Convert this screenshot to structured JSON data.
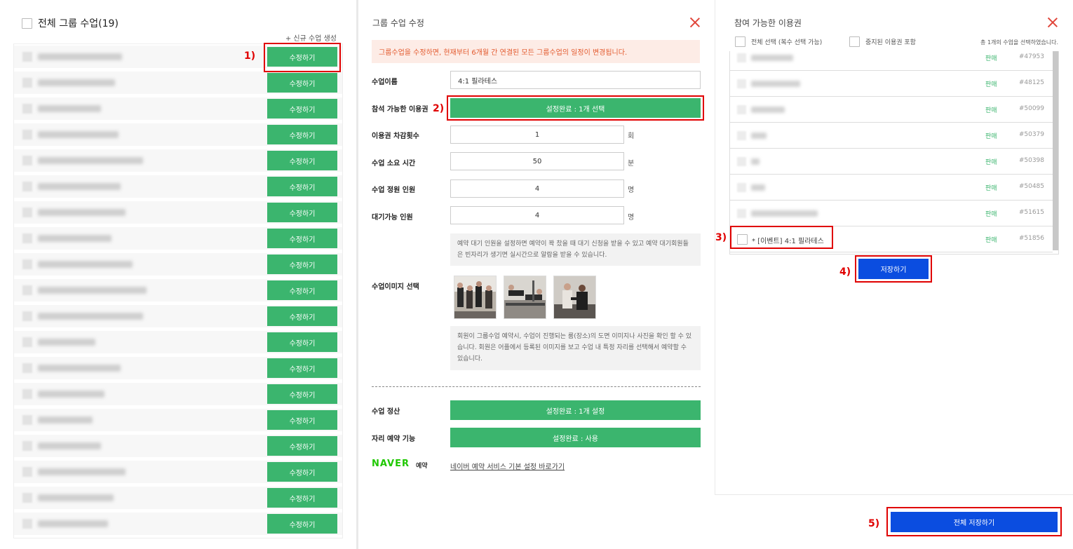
{
  "left": {
    "title": "전체 그룹 수업(19)",
    "new_link": "+ 신규 수업 생성",
    "edit_label": "수정하기",
    "rows": [
      {
        "w": 120
      },
      {
        "w": 110
      },
      {
        "w": 90
      },
      {
        "w": 115
      },
      {
        "w": 150
      },
      {
        "w": 118
      },
      {
        "w": 125
      },
      {
        "w": 105
      },
      {
        "w": 135
      },
      {
        "w": 155
      },
      {
        "w": 150
      },
      {
        "w": 82
      },
      {
        "w": 118
      },
      {
        "w": 95
      },
      {
        "w": 78
      },
      {
        "w": 90
      },
      {
        "w": 125
      },
      {
        "w": 108
      },
      {
        "w": 100
      }
    ]
  },
  "middle": {
    "title": "그룹 수업 수정",
    "warning": "그룹수업을 수정하면, 현재부터 6개월 간 연결된 모든 그룹수업의 일정이 변경됩니다.",
    "fields": {
      "name_label": "수업이름",
      "name_value": "4:1 필라테스",
      "pass_label": "참석 가능한 이용권",
      "pass_value": "설정완료 : 1개 선택",
      "deduct_label": "이용권 차감횟수",
      "deduct_value": "1",
      "deduct_unit": "회",
      "duration_label": "수업 소요 시간",
      "duration_value": "50",
      "duration_unit": "분",
      "capacity_label": "수업 정원 인원",
      "capacity_value": "4",
      "capacity_unit": "명",
      "waiting_label": "대기가능 인원",
      "waiting_value": "4",
      "waiting_unit": "명",
      "waiting_note": "예약 대기 인원을 설정하면 예약이 꽉 찼을 때 대기 신청을 받을 수 있고 예약 대기회원들은 빈자리가 생기면 실시간으로 알람을 받을 수 있습니다.",
      "image_label": "수업이미지 선택",
      "image_note": "회원이 그룹수업 예약시, 수업이 진행되는 룸(장소)의 도면 이미지나 사진을 확인 할 수 있습니다. 회원은 어플에서 등록된 이미지를 보고 수업 내 특정 자리를 선택해서 예약할 수 있습니다.",
      "settle_label": "수업 정산",
      "settle_value": "설정완료 : 1개 설정",
      "seat_label": "자리 예약 기능",
      "seat_value": "설정완료 : 사용",
      "naver_logo": "NAVER",
      "naver_sub": "예약",
      "naver_link": "네이버 예약 서비스 기본 설정 바로가기"
    }
  },
  "right": {
    "title": "참여 가능한 이용권",
    "select_all": "전체 선택 (복수 선택 가능)",
    "include_stopped": "중지된 이용권 포함",
    "count_text": "총 1개의 수업을 선택하였습니다.",
    "rows": [
      {
        "status": "판매",
        "id": "#47953",
        "w": 60
      },
      {
        "status": "판매",
        "id": "#48125",
        "w": 70
      },
      {
        "status": "판매",
        "id": "#50099",
        "w": 48
      },
      {
        "status": "판매",
        "id": "#50379",
        "w": 22
      },
      {
        "status": "판매",
        "id": "#50398",
        "w": 12
      },
      {
        "status": "판매",
        "id": "#50485",
        "w": 20
      },
      {
        "status": "판매",
        "id": "#51615",
        "w": 95
      },
      {
        "status": "판매",
        "id": "#51856",
        "label": "* [이벤트] 4:1 필라테스"
      }
    ],
    "save_label": "저장하기"
  },
  "footer": {
    "save_all_label": "전체 저장하기"
  },
  "annotations": [
    "1)",
    "2)",
    "3)",
    "4)",
    "5)"
  ],
  "colors": {
    "green": "#3bb56e",
    "blue": "#0b4de0",
    "red": "#e00000",
    "warn_bg": "#fdece6"
  }
}
